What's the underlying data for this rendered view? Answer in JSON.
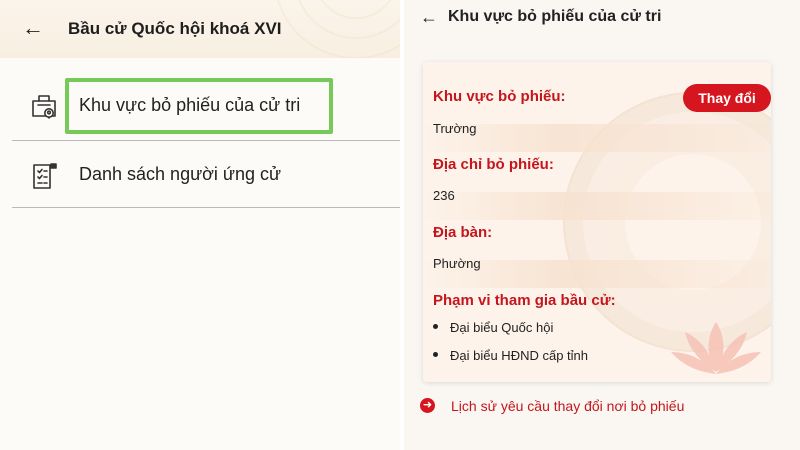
{
  "left": {
    "title": "Bầu cử Quốc hội khoá XVI",
    "menu": [
      {
        "label": "Khu vực bỏ phiếu của cử tri",
        "icon": "ballot-box-location-icon"
      },
      {
        "label": "Danh sách người ứng cử",
        "icon": "candidate-list-icon"
      }
    ]
  },
  "right": {
    "title": "Khu vực bỏ phiếu của cử tri",
    "change_button": "Thay đổi",
    "fields": [
      {
        "label": "Khu vực bỏ phiếu:",
        "value": "Trường"
      },
      {
        "label": "Địa chỉ bỏ phiếu:",
        "value": "236"
      },
      {
        "label": "Địa bàn:",
        "value": "Phường"
      }
    ],
    "scope": {
      "label": "Phạm vi tham gia bầu cử:",
      "items": [
        "Đại biểu Quốc hội",
        "Đại biểu HĐND cấp tỉnh"
      ]
    },
    "history_link": "Lịch sử yêu cầu thay đổi nơi bỏ phiếu"
  },
  "colors": {
    "accent_red": "#c4161c",
    "button_red": "#d5161f",
    "highlight_green": "#77c95a",
    "card_bg": "#fdf3ea"
  }
}
